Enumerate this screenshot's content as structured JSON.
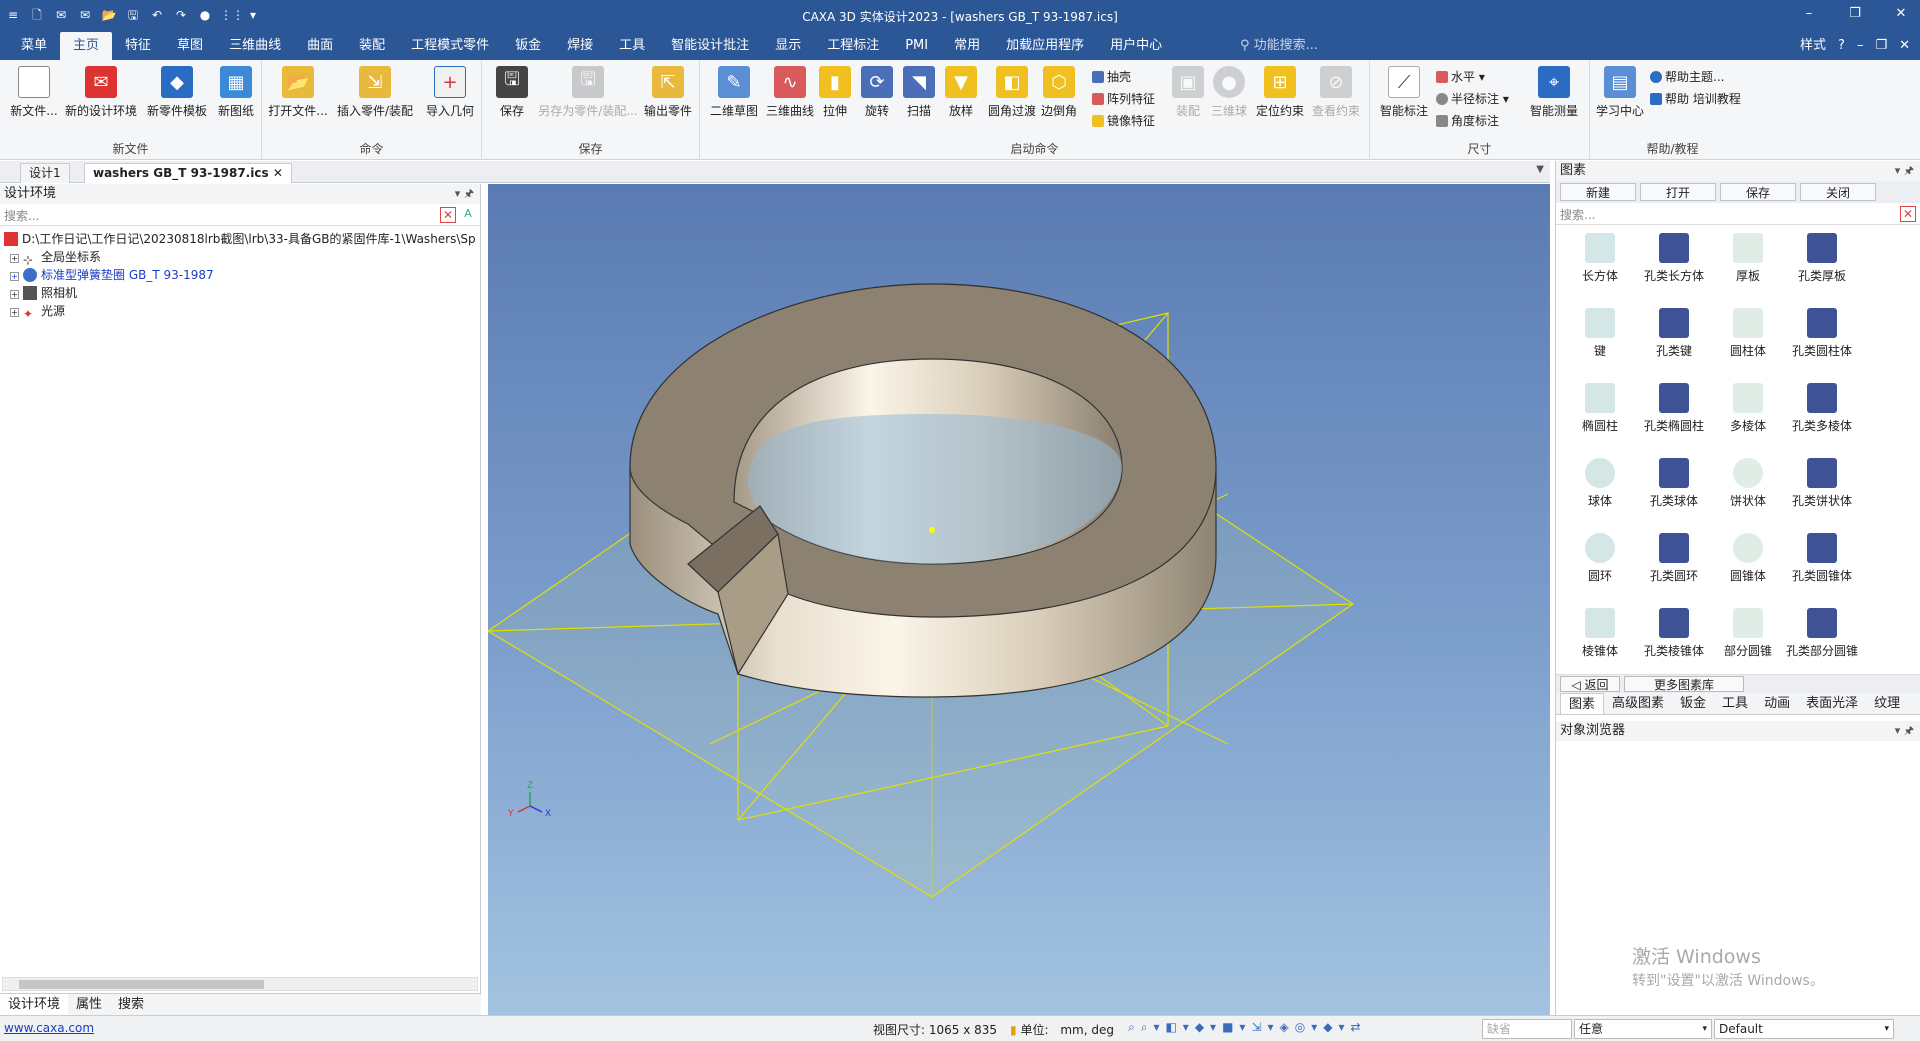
{
  "window": {
    "title": "CAXA 3D 实体设计2023 - [washers GB_T 93-1987.ics]",
    "min": "–",
    "restore": "❐",
    "close": "✕"
  },
  "quick_access": [
    "≡",
    "🗋",
    "✉",
    "✉",
    "📂",
    "🖫",
    "↶",
    "↷",
    "●",
    "⋮⋮",
    "▾"
  ],
  "menu": {
    "tabs": [
      "菜单",
      "主页",
      "特征",
      "草图",
      "三维曲线",
      "曲面",
      "装配",
      "工程模式零件",
      "钣金",
      "焊接",
      "工具",
      "智能设计批注",
      "显示",
      "工程标注",
      "PMI",
      "常用",
      "加载应用程序",
      "用户中心"
    ],
    "function_search": "功能搜索...",
    "style": "样式",
    "help": "?",
    "inner_min": "–",
    "inner_restore": "❐",
    "inner_close": "✕"
  },
  "ribbon": {
    "groups": [
      "新文件",
      "命令",
      "保存",
      "启动命令",
      "尺寸",
      "帮助/教程"
    ],
    "new_file": [
      "新文件...",
      "新的设计环境",
      "新零件模板",
      "新图纸"
    ],
    "command": [
      "打开文件...",
      "插入零件/装配",
      "导入几何"
    ],
    "save": [
      "保存",
      "另存为零件/装配...",
      "输出零件"
    ],
    "launch": [
      "二维草图",
      "三维曲线",
      "拉伸",
      "旋转",
      "扫描",
      "放样",
      "圆角过渡",
      "边倒角"
    ],
    "launch_small": [
      "抽壳",
      "阵列特征",
      "镜像特征"
    ],
    "launch_disabled": [
      "装配",
      "三维球",
      "定位约束",
      "查看约束"
    ],
    "dimension": [
      "智能标注"
    ],
    "dimension_small": [
      "水平",
      "半径标注",
      "角度标注"
    ],
    "dimension_measure": "智能测量",
    "help": [
      "学习中心"
    ],
    "help_small": [
      "帮助主题...",
      "帮助 培训教程"
    ]
  },
  "doc_tabs": [
    "设计1",
    "washers GB_T 93-1987.ics"
  ],
  "left_panel": {
    "title": "设计环境",
    "search_placeholder": "搜索...",
    "tree": {
      "root": "D:\\工作日记\\工作日记\\20230818lrb截图\\lrb\\33-具备GB的紧固件库-1\\Washers\\Sp",
      "items": [
        "全局坐标系",
        "标准型弹簧垫圈 GB_T 93-1987",
        "照相机",
        "光源"
      ]
    },
    "bottom_tabs": [
      "设计环境",
      "属性",
      "搜索"
    ]
  },
  "right_panel": {
    "title": "图素",
    "buttons": [
      "新建",
      "打开",
      "保存",
      "关闭"
    ],
    "search_placeholder": "搜索...",
    "items": [
      "长方体",
      "孔类长方体",
      "厚板",
      "孔类厚板",
      "键",
      "孔类键",
      "圆柱体",
      "孔类圆柱体",
      "椭圆柱",
      "孔类椭圆柱",
      "多棱体",
      "孔类多棱体",
      "球体",
      "孔类球体",
      "饼状体",
      "孔类饼状体",
      "圆环",
      "孔类圆环",
      "圆锥体",
      "孔类圆锥体",
      "棱锥体",
      "孔类棱锥体",
      "部分圆锥",
      "孔类部分圆锥"
    ],
    "back": "返回",
    "more": "更多图素库",
    "tabs": [
      "图素",
      "高级图素",
      "钣金",
      "工具",
      "动画",
      "表面光泽",
      "纹理"
    ],
    "object_browser": "对象浏览器"
  },
  "viewport": {
    "axis": {
      "z": "Z",
      "y": "Y",
      "x": "X"
    }
  },
  "watermark": {
    "line1": "激活 Windows",
    "line2": "转到\"设置\"以激活 Windows。"
  },
  "status": {
    "link": "www.caxa.com",
    "view_size_label": "视图尺寸:",
    "view_size": "1065 x 835",
    "unit_label": "单位:",
    "unit": "mm, deg",
    "sel1": "缺省",
    "sel2": "任意",
    "sel3": "Default"
  }
}
